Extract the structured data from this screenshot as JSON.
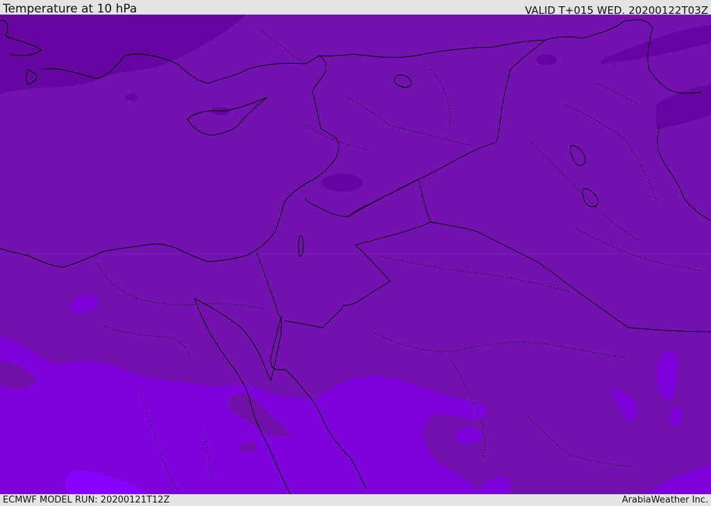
{
  "header": {
    "title": "Temperature at 10 hPa",
    "valid": "VALID T+015 WED. 20200122T03Z"
  },
  "footer": {
    "model_run": "ECMWF MODEL RUN: 20200121T12Z",
    "credit": "ArabiaWeather Inc."
  },
  "colors": {
    "base_field": "#7412b0",
    "cold_band": "#6606a0",
    "warm_band": "#7f04dc",
    "warmest_patch": "#8a00ff",
    "mid_patch": "#7010a8",
    "coastline": "#000000",
    "bars": "#e4e4e4"
  },
  "map": {
    "region": "Eastern Mediterranean / Middle East",
    "overlays": [
      "coastline",
      "country-borders",
      "province-borders-dotted",
      "temperature-shading"
    ]
  }
}
